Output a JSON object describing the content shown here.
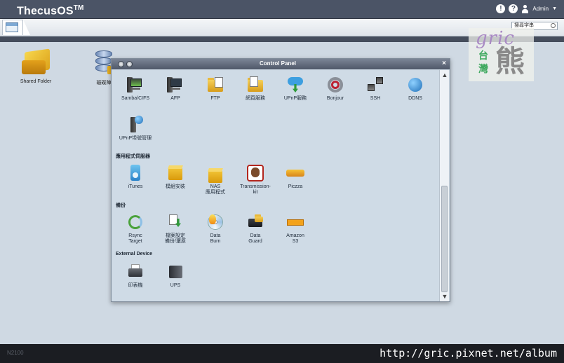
{
  "app": {
    "brand": "ThecusOS",
    "brand_tm": "TM",
    "user": "Admin"
  },
  "toolbar": {
    "search_placeholder": "搜尋字串"
  },
  "desktop": {
    "icons": [
      {
        "label": "Shared Folder",
        "icon": "folder-icon"
      },
      {
        "label": "磁碟陣",
        "icon": "database-icon"
      }
    ]
  },
  "watermark": {
    "word": "gric",
    "tw": "台灣",
    "bear": "熊"
  },
  "control_panel": {
    "title": "Control Panel",
    "close": "×",
    "network_items": [
      {
        "label": "Samba/CIFS",
        "icon": "samba-icon"
      },
      {
        "label": "AFP",
        "icon": "afp-icon"
      },
      {
        "label": "FTP",
        "icon": "ftp-icon"
      },
      {
        "label": "網頁服務",
        "icon": "web-service-icon"
      },
      {
        "label": "UPnP服務",
        "icon": "upnp-icon"
      },
      {
        "label": "Bonjour",
        "icon": "bonjour-icon"
      },
      {
        "label": "SSH",
        "icon": "ssh-icon"
      },
      {
        "label": "DDNS",
        "icon": "ddns-icon"
      },
      {
        "label": "UPnP埠號管理",
        "icon": "upnp-port-icon"
      }
    ],
    "app_section": "應用程式伺服器",
    "app_items": [
      {
        "label": "iTunes",
        "icon": "itunes-icon"
      },
      {
        "label": "模組安裝",
        "icon": "module-install-icon"
      },
      {
        "label": "NAS",
        "label2": "應用程式",
        "icon": "nas-app-icon"
      },
      {
        "label": "Transmission-",
        "label2": "kit",
        "icon": "transmission-icon"
      },
      {
        "label": "Piczza",
        "icon": "piczza-icon"
      }
    ],
    "backup_section": "備份",
    "backup_items": [
      {
        "label": "Rsync",
        "label2": "Target",
        "icon": "rsync-icon"
      },
      {
        "label": "檔案設定",
        "label2": "備份/還原",
        "icon": "config-backup-icon"
      },
      {
        "label": "Data",
        "label2": "Burn",
        "icon": "data-burn-icon"
      },
      {
        "label": "Data",
        "label2": "Guard",
        "icon": "data-guard-icon"
      },
      {
        "label": "Amazon",
        "label2": "S3",
        "icon": "amazon-s3-icon"
      }
    ],
    "external_section": "External Device",
    "external_items": [
      {
        "label": "印表機",
        "icon": "printer-icon"
      },
      {
        "label": "UPS",
        "icon": "ups-icon"
      }
    ]
  },
  "bottom": {
    "model": "N2100",
    "url": "http://gric.pixnet.net/album"
  }
}
